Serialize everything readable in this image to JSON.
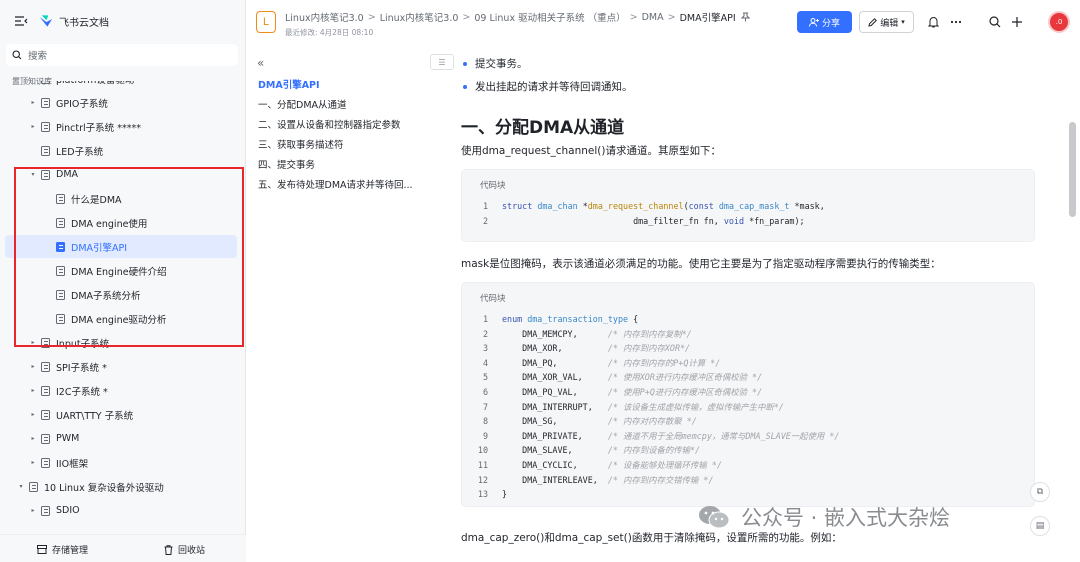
{
  "app": {
    "name": "飞书云文档",
    "search_placeholder": "搜索",
    "section": "置顶知识库"
  },
  "sidebar": {
    "items": [
      {
        "label": "platform设备驱动",
        "depth": 1,
        "arrow": "▸",
        "active": false
      },
      {
        "label": "GPIO子系统",
        "depth": 1,
        "arrow": "▸",
        "active": false
      },
      {
        "label": "Pinctrl子系统 *****",
        "depth": 1,
        "arrow": "▸",
        "active": false
      },
      {
        "label": "LED子系统",
        "depth": 1,
        "arrow": "",
        "active": false
      },
      {
        "label": "DMA",
        "depth": 1,
        "arrow": "▾",
        "active": false
      },
      {
        "label": "什么是DMA",
        "depth": 2,
        "arrow": "",
        "active": false
      },
      {
        "label": "DMA engine使用",
        "depth": 2,
        "arrow": "",
        "active": false
      },
      {
        "label": "DMA引擎API",
        "depth": 2,
        "arrow": "",
        "active": true
      },
      {
        "label": "DMA Engine硬件介绍",
        "depth": 2,
        "arrow": "",
        "active": false
      },
      {
        "label": "DMA子系统分析",
        "depth": 2,
        "arrow": "",
        "active": false
      },
      {
        "label": "DMA engine驱动分析",
        "depth": 2,
        "arrow": "",
        "active": false
      },
      {
        "label": "Input子系统",
        "depth": 1,
        "arrow": "▸",
        "active": false
      },
      {
        "label": "SPI子系统 *",
        "depth": 1,
        "arrow": "▸",
        "active": false
      },
      {
        "label": "I2C子系统 *",
        "depth": 1,
        "arrow": "▸",
        "active": false
      },
      {
        "label": "UART\\TTY 子系统",
        "depth": 1,
        "arrow": "▸",
        "active": false
      },
      {
        "label": "PWM",
        "depth": 1,
        "arrow": "▸",
        "active": false
      },
      {
        "label": "IIO框架",
        "depth": 1,
        "arrow": "▸",
        "active": false
      },
      {
        "label": "10 Linux 复杂设备外设驱动",
        "depth": 0,
        "arrow": "▾",
        "active": false
      },
      {
        "label": "SDIO",
        "depth": 1,
        "arrow": "▸",
        "active": false
      }
    ],
    "footer": {
      "storage": "存储管理",
      "trash": "回收站"
    }
  },
  "header": {
    "badge": "L",
    "breadcrumbs": [
      "Linux内核笔记3.0",
      "Linux内核笔记3.0",
      "09 Linux 驱动相关子系统 （重点）",
      "DMA"
    ],
    "current": "DMA引擎API",
    "modified": "最近修改: 4月28日 08:10",
    "share": "分享",
    "edit": "编辑",
    "avatar_text": ".0"
  },
  "outline": {
    "items": [
      {
        "label": "DMA引擎API",
        "active": true
      },
      {
        "label": "一、分配DMA从通道",
        "active": false
      },
      {
        "label": "二、设置从设备和控制器指定参数",
        "active": false
      },
      {
        "label": "三、获取事务描述符",
        "active": false
      },
      {
        "label": "四、提交事务",
        "active": false
      },
      {
        "label": "五、发布待处理DMA请求并等待回...",
        "active": false
      }
    ]
  },
  "doc": {
    "bullets": [
      "提交事务。",
      "发出挂起的请求并等待回调通知。"
    ],
    "heading": "一、分配DMA从通道",
    "p1": "使用dma_request_channel()请求通道。其原型如下：",
    "code_label": "代码块",
    "code1": [
      {
        "n": "1",
        "html": "<span class=\"kw\">struct</span> <span class=\"ty\">dma_chan</span> *<span class=\"fn\">dma_request_channel</span>(<span class=\"kw\">const</span> <span class=\"ty\">dma_cap_mask_t</span> *mask,"
      },
      {
        "n": "2",
        "html": "                          dma_filter_fn fn, <span class=\"kw\">void</span> *fn_param);"
      }
    ],
    "p2": "mask是位图掩码，表示该通道必须满足的功能。使用它主要是为了指定驱动程序需要执行的传输类型：",
    "code2": [
      {
        "n": "1",
        "html": "<span class=\"kw\">enum</span> <span class=\"ty\">dma_transaction_type</span> {"
      },
      {
        "n": "2",
        "html": "    DMA_MEMCPY,      <span class=\"cm\">/* 内存到内存复制*/</span>"
      },
      {
        "n": "3",
        "html": "    DMA_XOR,         <span class=\"cm\">/* 内存到内存XOR*/</span>"
      },
      {
        "n": "4",
        "html": "    DMA_PQ,          <span class=\"cm\">/* 内存到内存的P+Q计算 */</span>"
      },
      {
        "n": "5",
        "html": "    DMA_XOR_VAL,     <span class=\"cm\">/* 使用XOR进行内存缓冲区奇偶校验 */</span>"
      },
      {
        "n": "6",
        "html": "    DMA_PQ_VAL,      <span class=\"cm\">/* 使用P+Q进行内存缓冲区奇偶校验 */</span>"
      },
      {
        "n": "7",
        "html": "    DMA_INTERRUPT,   <span class=\"cm\">/* 该设备生成虚拟传输，虚拟传输产生中断*/</span>"
      },
      {
        "n": "8",
        "html": "    DMA_SG,          <span class=\"cm\">/* 内存对内存散聚 */</span>"
      },
      {
        "n": "9",
        "html": "    DMA_PRIVATE,     <span class=\"cm\">/* 通道不用于全局memcpy，通常与DMA_SLAVE一起使用 */</span>"
      },
      {
        "n": "10",
        "html": "    DMA_SLAVE,       <span class=\"cm\">/* 内存到设备的传输*/</span>"
      },
      {
        "n": "11",
        "html": "    DMA_CYCLIC,      <span class=\"cm\">/* 设备能够处理循环传输 */</span>"
      },
      {
        "n": "12",
        "html": "    DMA_INTERLEAVE,  <span class=\"cm\">/* 内存到内存交错传输 */</span>"
      },
      {
        "n": "13",
        "html": "}"
      }
    ],
    "p3": "dma_cap_zero()和dma_cap_set()函数用于清除掩码，设置所需的功能。例如："
  },
  "watermark": "公众号 · 嵌入式大杂烩"
}
